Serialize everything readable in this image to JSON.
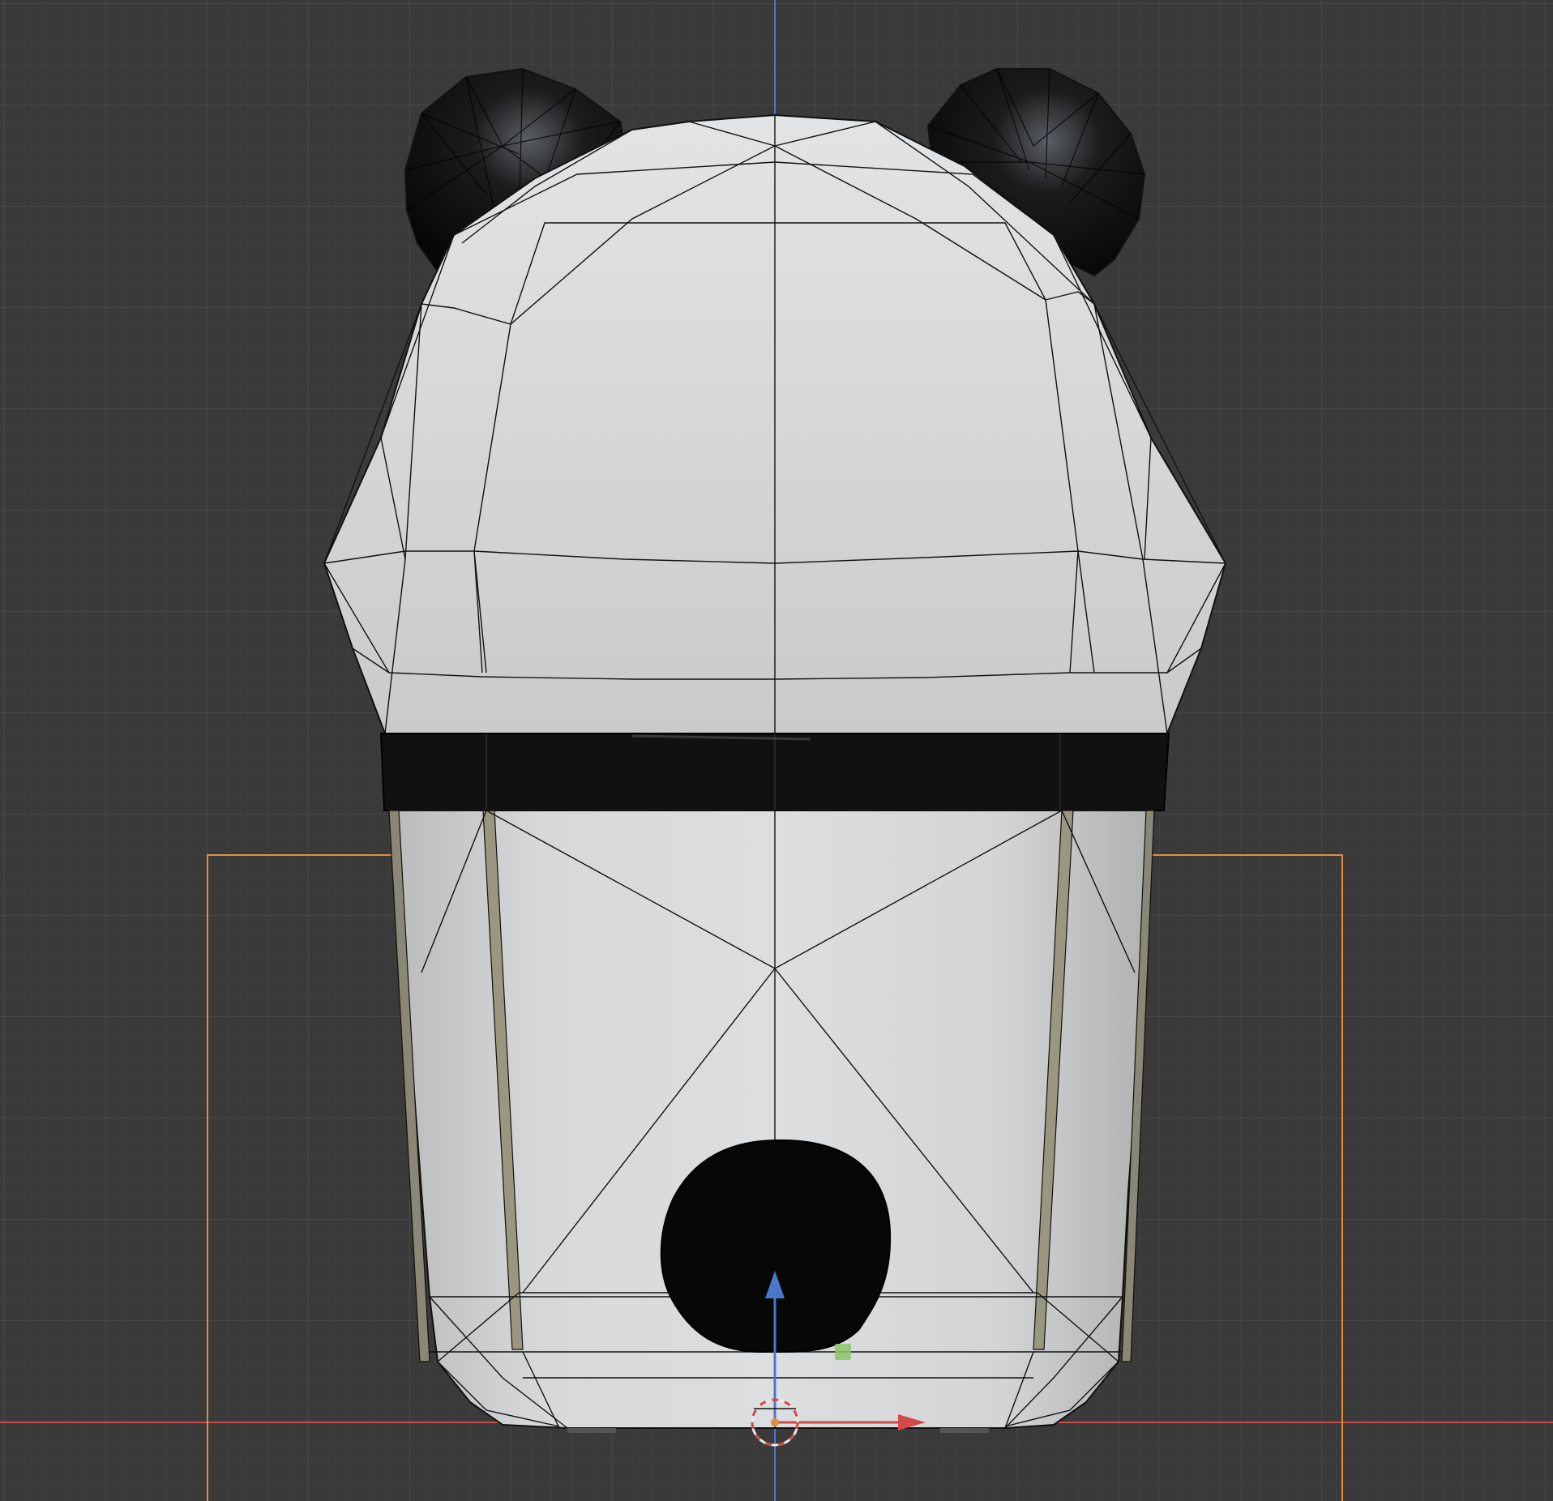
{
  "app": {
    "name": "",
    "view": ""
  },
  "viewport": {
    "background": "#3a3a3a",
    "grid_minor_color": "#444444",
    "grid_major_color": "#4d4d4d",
    "axis_x_color": "#d04a4a",
    "axis_z_color": "#4a78c8",
    "camera_frame_color": "#e0903c"
  },
  "scene": {
    "object": "panda-cup",
    "materials": {
      "body": "#d4d6d8",
      "ears": "#141414",
      "band": "#111111",
      "nose": "#080808",
      "wire": "#111111"
    },
    "gizmo": {
      "type": "move-gizmo",
      "active_axis": "none"
    }
  }
}
